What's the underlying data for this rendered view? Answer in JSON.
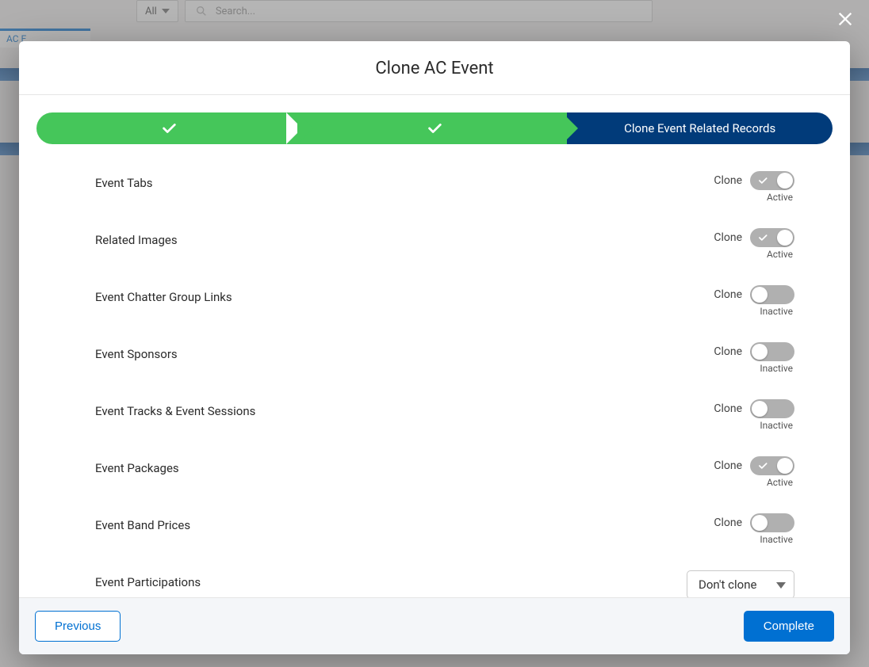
{
  "bg": {
    "all_label": "All",
    "search_placeholder": "Search...",
    "tab_label": "AC E"
  },
  "modal": {
    "title": "Clone AC Event",
    "step3_label": "Clone Event Related Records",
    "clone_word": "Clone",
    "active_word": "Active",
    "inactive_word": "Inactive",
    "rows": {
      "0": {
        "label": "Event Tabs",
        "on": true
      },
      "1": {
        "label": "Related Images",
        "on": true
      },
      "2": {
        "label": "Event Chatter Group Links",
        "on": false
      },
      "3": {
        "label": "Event Sponsors",
        "on": false
      },
      "4": {
        "label": "Event Tracks & Event Sessions",
        "on": false
      },
      "5": {
        "label": "Event Packages",
        "on": true
      },
      "6": {
        "label": "Event Band Prices",
        "on": false
      }
    },
    "participations_label": "Event Participations",
    "participations_select": "Don't clone",
    "btn_prev": "Previous",
    "btn_complete": "Complete"
  }
}
